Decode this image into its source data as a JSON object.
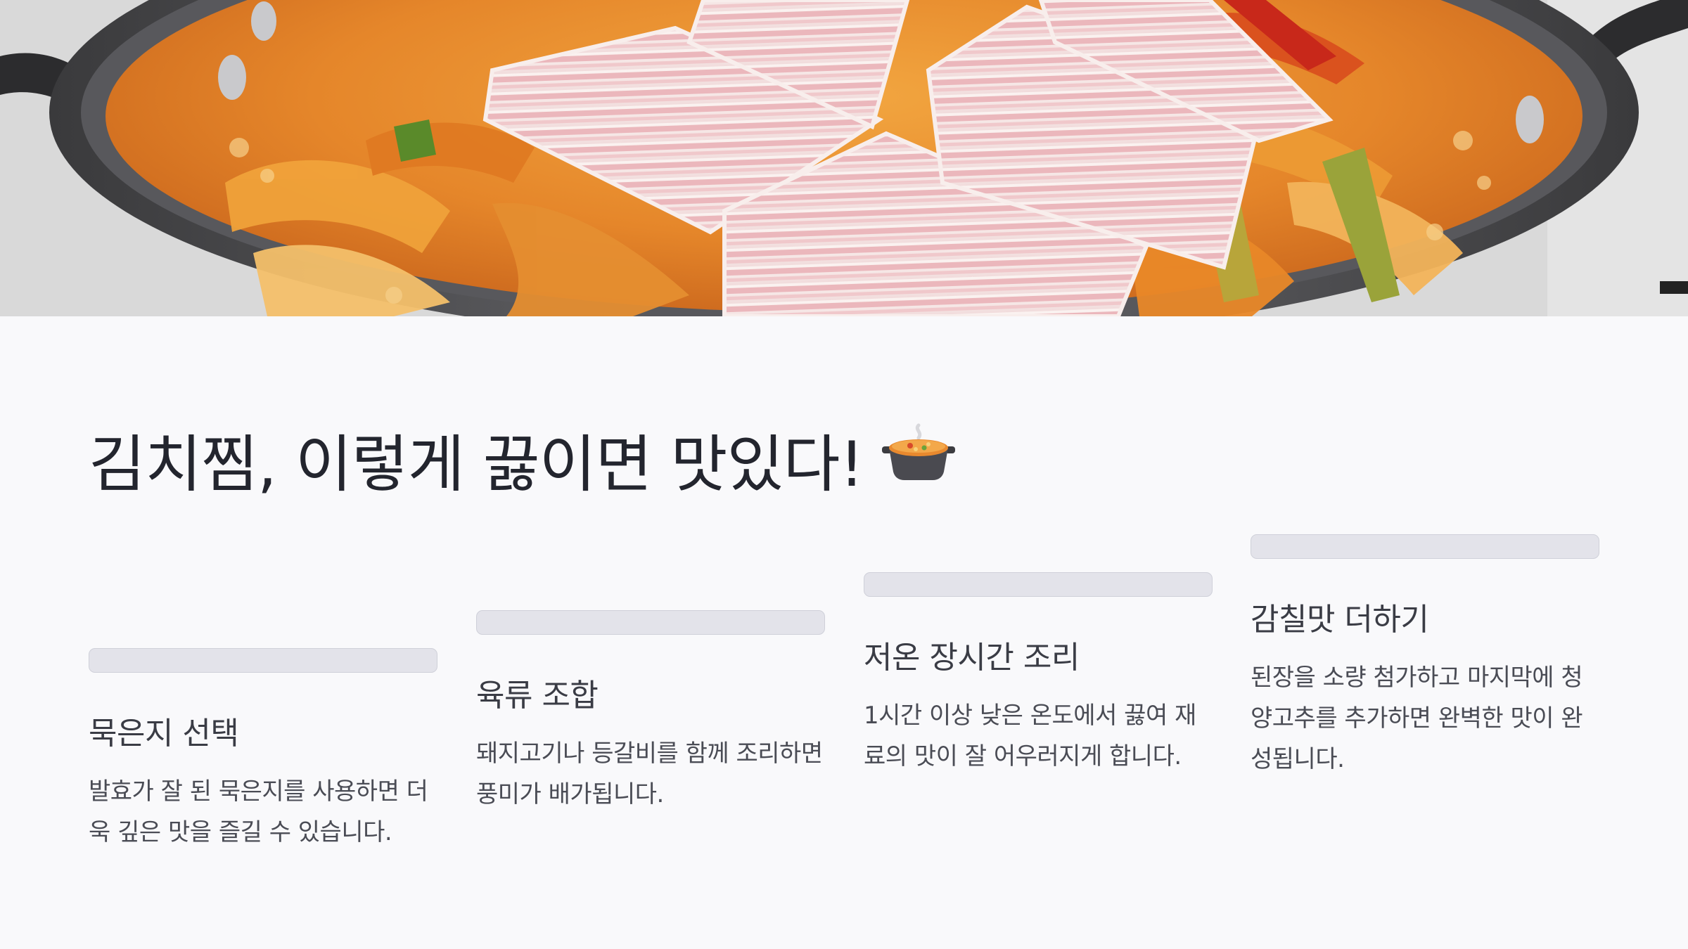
{
  "hero": {
    "alt": "kimchi-jjim-with-pork-belly-photo"
  },
  "title": {
    "text": "김치찜, 이렇게 끓이면 맛있다!",
    "emoji_icon": "pot-of-food-icon"
  },
  "steps": [
    {
      "title": "묵은지 선택",
      "description": "발효가 잘 된 묵은지를 사용하면 더욱 깊은 맛을 즐길 수 있습니다."
    },
    {
      "title": "육류 조합",
      "description": "돼지고기나 등갈비를 함께 조리하면 풍미가 배가됩니다."
    },
    {
      "title": "저온 장시간 조리",
      "description": "1시간 이상 낮은 온도에서 끓여 재료의 맛이 잘 어우러지게 합니다."
    },
    {
      "title": "감칠맛 더하기",
      "description": "된장을 소량 첨가하고 마지막에 청양고추를 추가하면 완벽한 맛이 완성됩니다."
    }
  ],
  "colors": {
    "background": "#f9f9fb",
    "bar": "#e3e3ea",
    "title_text": "#23252e",
    "broth": "#e88a2a"
  }
}
